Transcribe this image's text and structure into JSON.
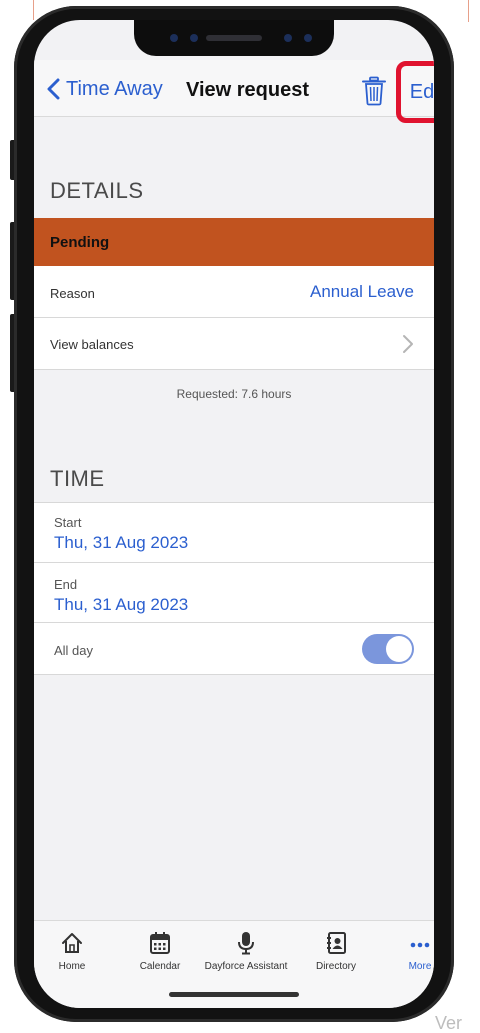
{
  "nav": {
    "back_label": "Time Away",
    "title": "View request",
    "edit_label": "Edit"
  },
  "details": {
    "header": "DETAILS",
    "status": "Pending",
    "reason_label": "Reason",
    "reason_value": "Annual Leave",
    "view_balances_label": "View balances",
    "requested_note": "Requested: 7.6 hours"
  },
  "time": {
    "header": "TIME",
    "start_label": "Start",
    "start_value": "Thu, 31 Aug 2023",
    "end_label": "End",
    "end_value": "Thu, 31 Aug 2023",
    "all_day_label": "All day",
    "all_day_on": true
  },
  "tabs": [
    {
      "label": "Home",
      "icon": "home-icon"
    },
    {
      "label": "Calendar",
      "icon": "calendar-icon"
    },
    {
      "label": "Dayforce Assistant",
      "icon": "microphone-icon"
    },
    {
      "label": "Directory",
      "icon": "contact-book-icon"
    },
    {
      "label": "More",
      "icon": "more-dots-icon",
      "active": true
    }
  ],
  "corner_text": "Ver",
  "colors": {
    "accent": "#2b5fcf",
    "status_pending": "#c1531f",
    "highlight_box": "#e0132f",
    "toggle_on": "#7b96dc"
  }
}
